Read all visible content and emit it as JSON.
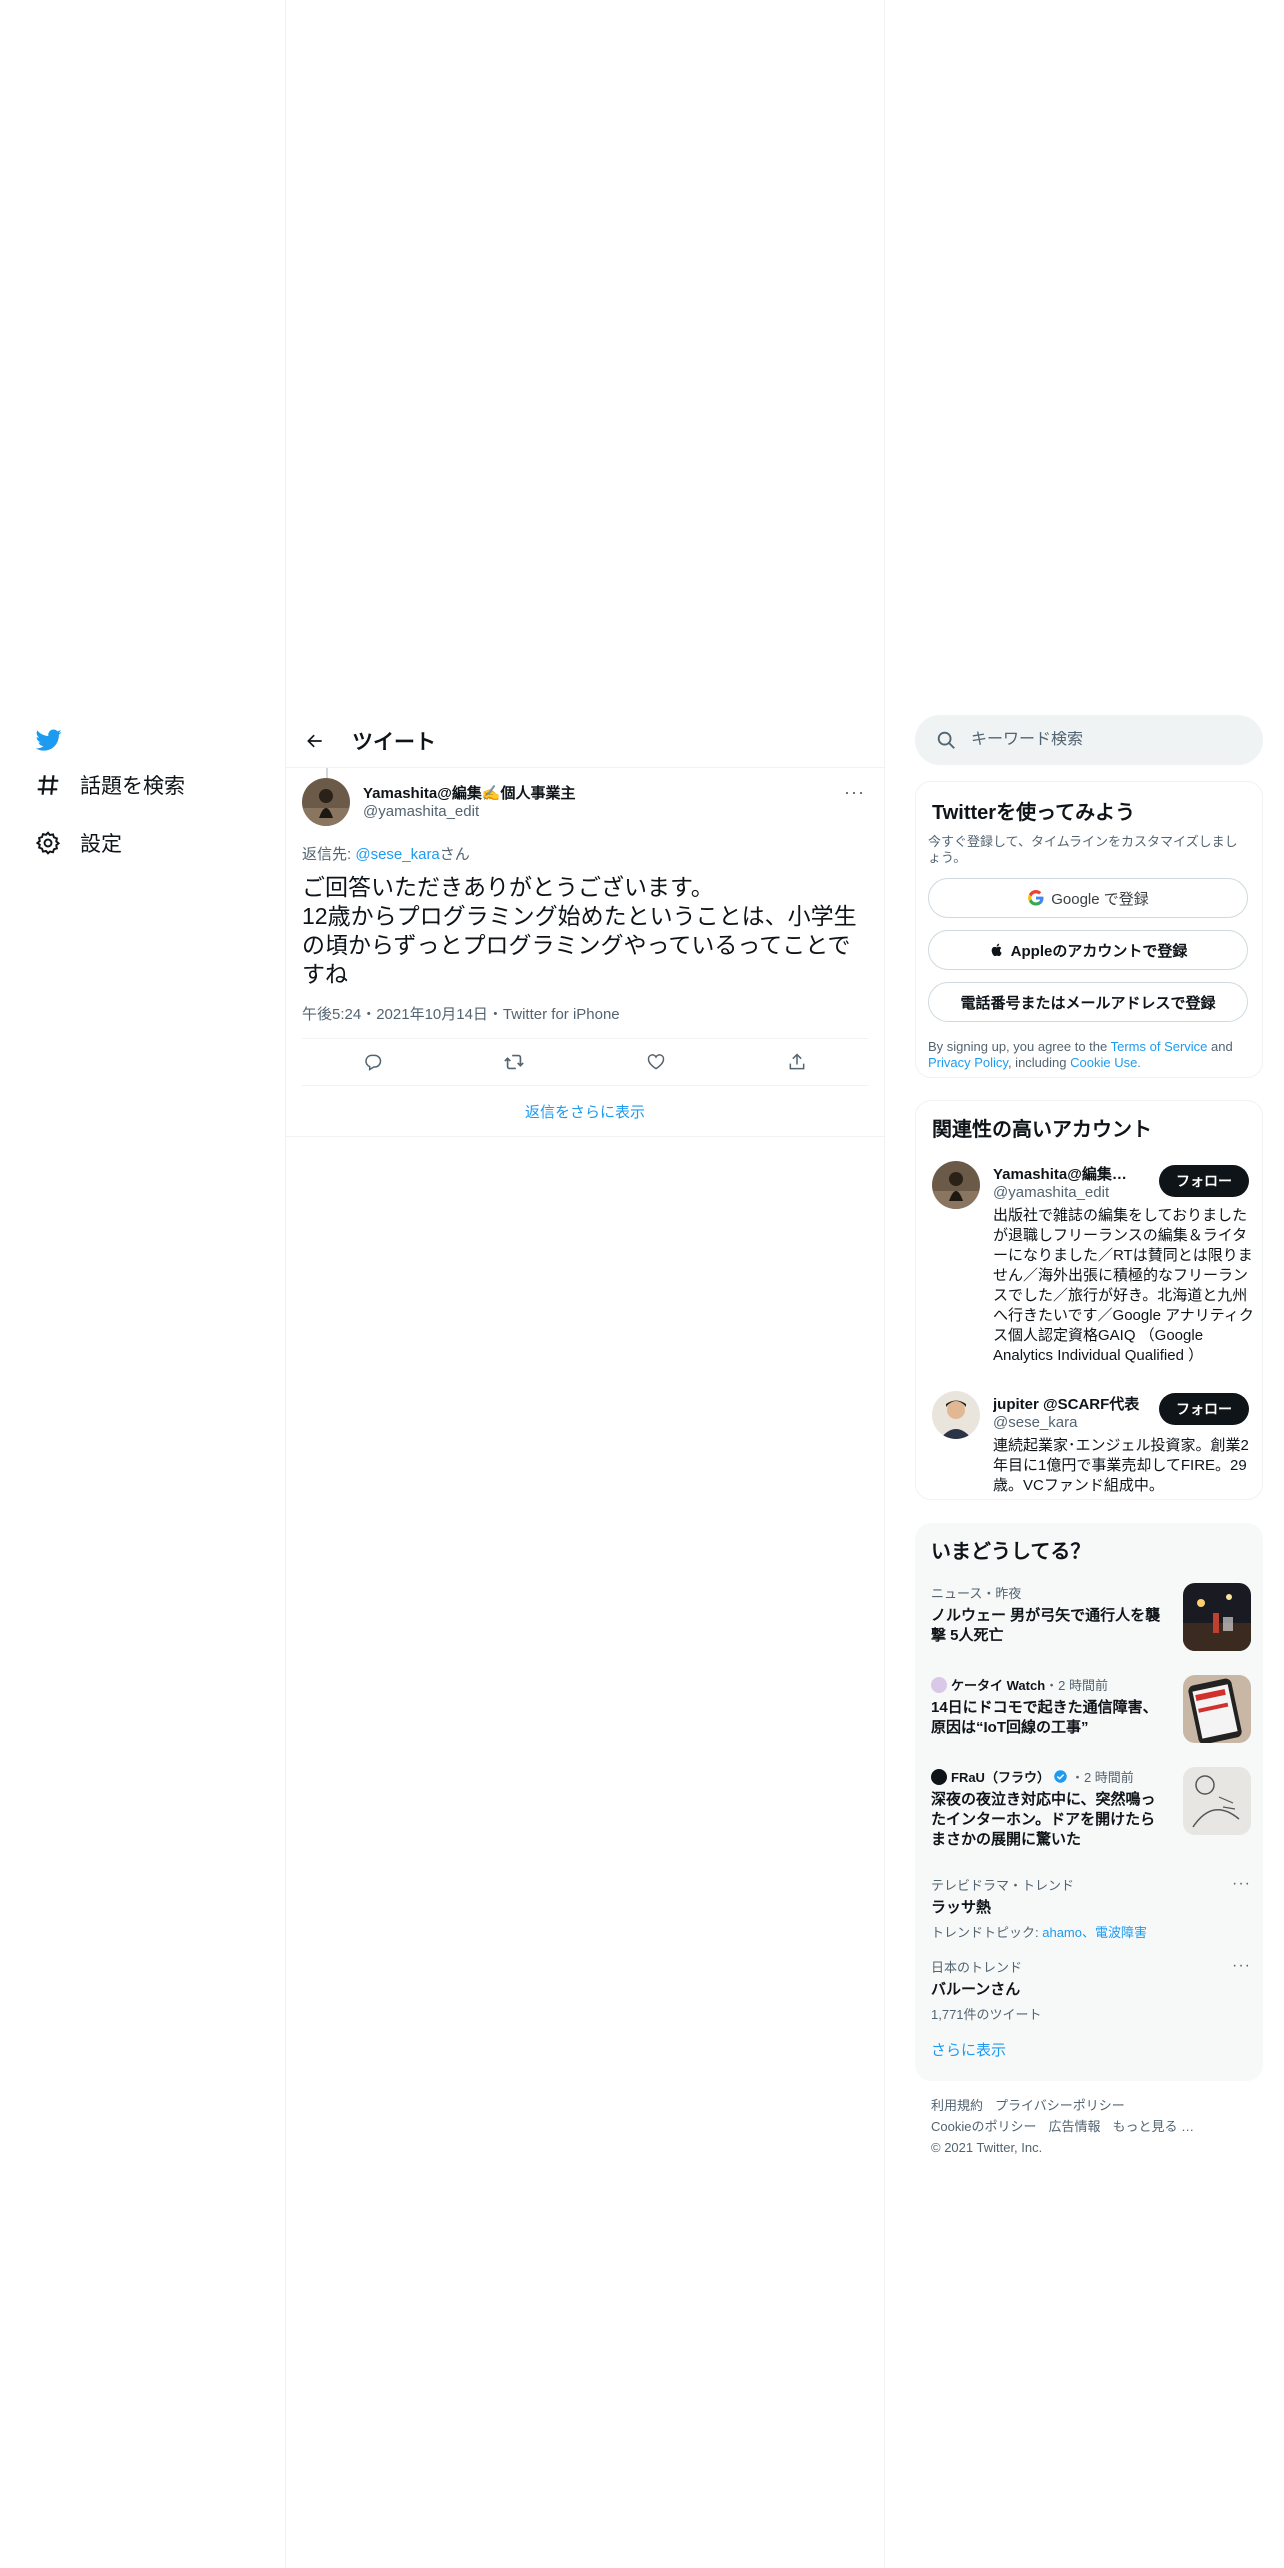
{
  "nav": {
    "items": [
      {
        "label": "話題を検索",
        "icon": "hashtag-icon"
      },
      {
        "label": "設定",
        "icon": "gear-icon"
      }
    ],
    "brand_color": "#1d9bf0"
  },
  "header": {
    "title": "ツイート"
  },
  "tweet": {
    "author_name": "Yamashita@編集✍️個人事業主",
    "author_handle": "@yamashita_edit",
    "reply_prefix": "返信先: ",
    "reply_handle": "@sese_kara",
    "reply_suffix": "さん",
    "text": "ご回答いただきありがとうございます。\n12歳からプログラミング始めたということは、小学生の頃からずっとプログラミングやっているってことですね",
    "meta": "午後5:24・2021年10月14日・Twitter for iPhone",
    "show_more": "返信をさらに表示"
  },
  "search": {
    "placeholder": "キーワード検索"
  },
  "signup": {
    "title": "Twitterを使ってみよう",
    "subtitle": "今すぐ登録して、タイムラインをカスタマイズしましょう。",
    "google_label": "Google で登録",
    "apple_label": "Appleのアカウントで登録",
    "phone_label": "電話番号またはメールアドレスで登録",
    "terms_pre": "By signing up, you agree to the ",
    "terms_link": "Terms of Service",
    "terms_and": " and ",
    "privacy_link": "Privacy Policy",
    "terms_mid": ", including ",
    "cookie_link": "Cookie Use."
  },
  "related": {
    "title": "関連性の高いアカウント",
    "follow_label": "フォロー",
    "accounts": [
      {
        "name": "Yamashita@編集✍️個人事業主",
        "handle": "@yamashita_edit",
        "bio": "出版社で雑誌の編集をしておりましたが退職しフリーランスの編集＆ライターになりました／RTは賛同とは限りません／海外出張に積極的なフリーランスでした／旅行が好き。北海道と九州へ行きたいです／Google アナリティクス個人認定資格GAIQ （Google Analytics Individual Qualified ）"
      },
      {
        "name": "jupiter @SCARF代表",
        "handle": "@sese_kara",
        "bio": "連続起業家･エンジェル投資家。創業2年目に1億円で事業売却してFIRE。29歳。VCファンド組成中。"
      }
    ]
  },
  "trends": {
    "title": "いまどうしてる？",
    "items": [
      {
        "context": "ニュース・昨夜",
        "title": "ノルウェー 男が弓矢で通行人を襲撃 5人死亡"
      },
      {
        "source": "ケータイ Watch",
        "time": "・2 時間前",
        "title": "14日にドコモで起きた通信障害、原因は“IoT回線の工事”"
      },
      {
        "source": "FRaU（フラウ）",
        "time": "・2 時間前",
        "title": "深夜の夜泣き対応中に、突然鳴ったインターホン。ドアを開けたらまさかの展開に驚いた"
      },
      {
        "context": "テレビドラマ・トレンド",
        "title": "ラッサ熱",
        "sub_prefix": "トレンドトピック: ",
        "topics": "ahamo、電波障害"
      },
      {
        "context": "日本のトレンド",
        "title": "バルーンさん",
        "sub": "1,771件のツイート"
      }
    ],
    "show_more": "さらに表示"
  },
  "footer": {
    "links": [
      "利用規約",
      "プライバシーポリシー",
      "Cookieのポリシー",
      "広告情報",
      "もっと見る …"
    ],
    "copyright": "© 2021 Twitter, Inc."
  }
}
